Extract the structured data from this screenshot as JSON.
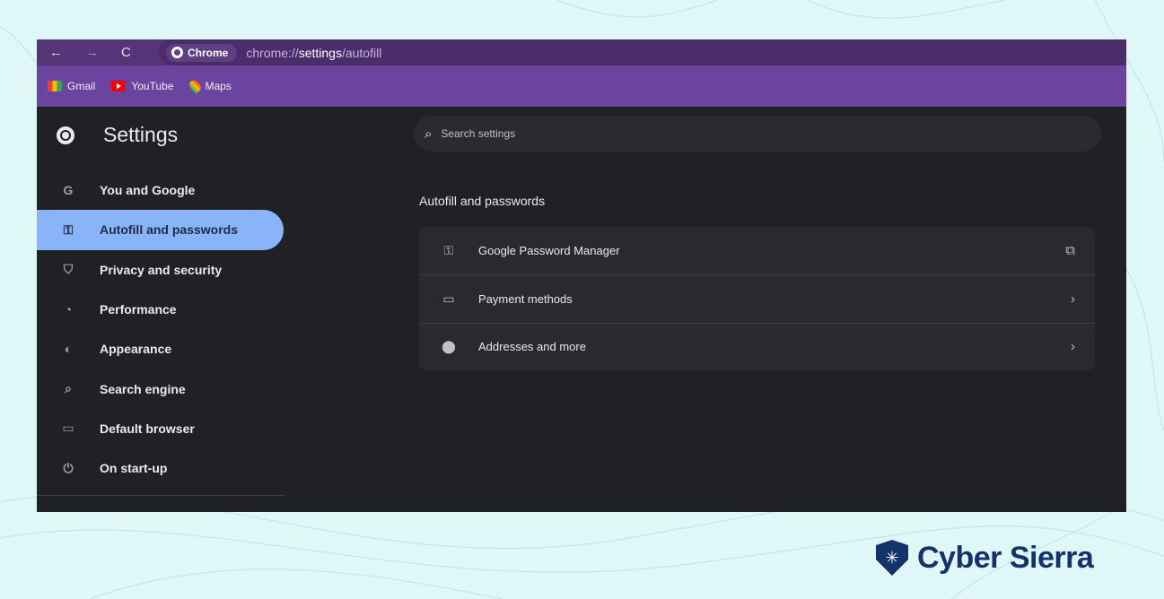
{
  "toolbar": {
    "back_icon": "←",
    "forward_icon": "→",
    "reload_icon": "C",
    "chip_label": "Chrome",
    "url_prefix": "chrome://",
    "url_bold": "settings",
    "url_suffix": "/autofill"
  },
  "bookmarks": [
    {
      "label": "Gmail",
      "icon": "gmail-icon"
    },
    {
      "label": "YouTube",
      "icon": "youtube-icon"
    },
    {
      "label": "Maps",
      "icon": "maps-icon"
    }
  ],
  "sidebar": {
    "title": "Settings",
    "items": [
      {
        "label": "You and Google",
        "icon": "G",
        "active": false
      },
      {
        "label": "Autofill and passwords",
        "icon": "⚿",
        "active": true
      },
      {
        "label": "Privacy and security",
        "icon": "⛉",
        "active": false
      },
      {
        "label": "Performance",
        "icon": "◔",
        "active": false
      },
      {
        "label": "Appearance",
        "icon": "◐",
        "active": false
      },
      {
        "label": "Search engine",
        "icon": "⌕",
        "active": false
      },
      {
        "label": "Default browser",
        "icon": "▭",
        "active": false
      },
      {
        "label": "On start-up",
        "icon": "⏻",
        "active": false
      }
    ]
  },
  "main": {
    "search_placeholder": "Search settings",
    "search_icon": "⌕",
    "section_title": "Autofill and passwords",
    "rows": [
      {
        "label": "Google Password Manager",
        "icon": "⚿",
        "end": "⧉"
      },
      {
        "label": "Payment methods",
        "icon": "▭",
        "end": "›"
      },
      {
        "label": "Addresses and more",
        "icon": "⬤",
        "end": "›"
      }
    ]
  },
  "brand": {
    "name": "Cyber Sierra",
    "color": "#15336b"
  },
  "colors": {
    "toolbar": "#553577",
    "bookmarks_bar": "#6b44a0",
    "active_item": "#8ab4f8",
    "background": "#dff7f7"
  }
}
